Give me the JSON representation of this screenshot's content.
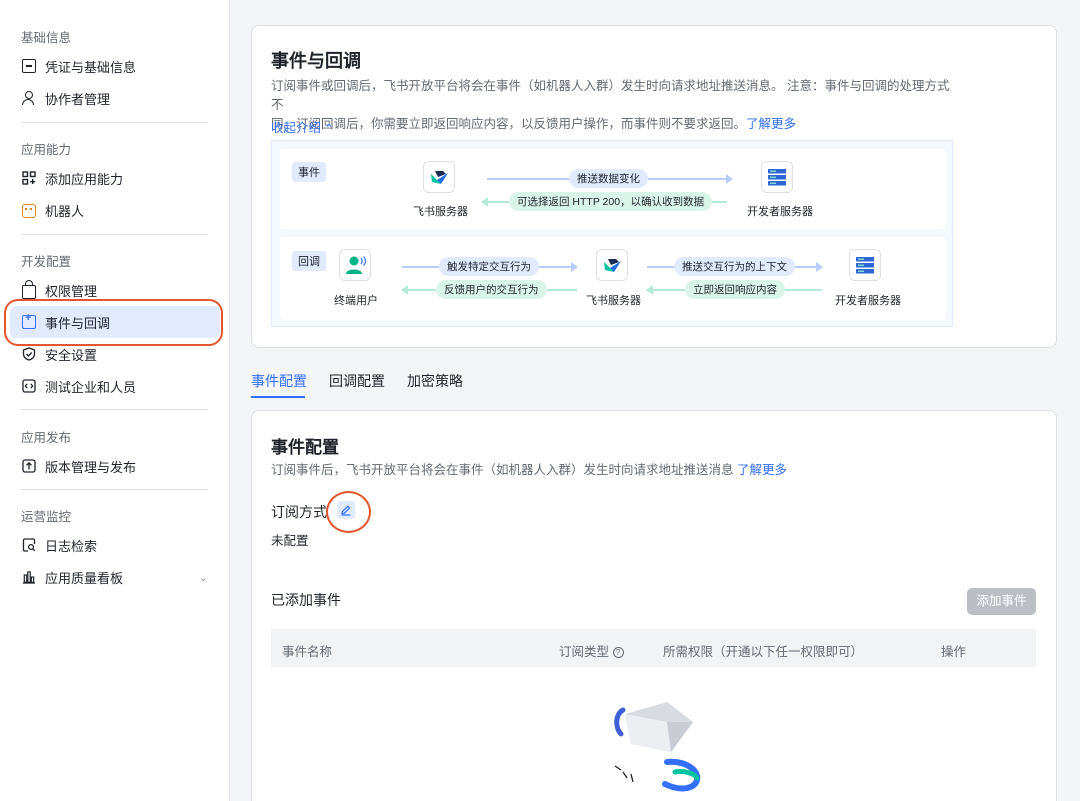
{
  "sidebar": {
    "groups": [
      {
        "title": "基础信息"
      },
      {
        "title": "应用能力"
      },
      {
        "title": "开发配置"
      },
      {
        "title": "应用发布"
      },
      {
        "title": "运营监控"
      }
    ],
    "items": [
      {
        "label": "凭证与基础信息",
        "icon": "credential-icon"
      },
      {
        "label": "协作者管理",
        "icon": "collaborator-icon"
      },
      {
        "label": "添加应用能力",
        "icon": "add-capability-icon"
      },
      {
        "label": "机器人",
        "icon": "robot-icon"
      },
      {
        "label": "权限管理",
        "icon": "lock-icon"
      },
      {
        "label": "事件与回调",
        "icon": "event-icon",
        "active": true
      },
      {
        "label": "安全设置",
        "icon": "shield-icon"
      },
      {
        "label": "测试企业和人员",
        "icon": "code-icon"
      },
      {
        "label": "版本管理与发布",
        "icon": "upload-icon"
      },
      {
        "label": "日志检索",
        "icon": "log-search-icon"
      },
      {
        "label": "应用质量看板",
        "icon": "chart-icon"
      }
    ]
  },
  "intro": {
    "title": "事件与回调",
    "description_line1": "订阅事件或回调后，飞书开放平台将会在事件（如机器人入群）发生时向请求地址推送消息。 注意：事件与回调的处理方式不",
    "description_line2": "同。订阅回调后，你需要立即返回响应内容，以反馈用户操作，而事件则不要求返回。",
    "learn_more": "了解更多",
    "collapse": "收起介绍",
    "diagram": {
      "event_tag": "事件",
      "callback_tag": "回调",
      "feishu_server": "飞书服务器",
      "developer_server": "开发者服务器",
      "end_user": "终端用户",
      "push_data_change": "推送数据变化",
      "optional_return": "可选择返回 HTTP 200，以确认收到数据",
      "trigger_interaction": "触发特定交互行为",
      "feedback_interaction": "反馈用户的交互行为",
      "push_context": "推送交互行为的上下文",
      "return_response": "立即返回响应内容"
    }
  },
  "tabs": [
    "事件配置",
    "回调配置",
    "加密策略"
  ],
  "event_config": {
    "title": "事件配置",
    "description": "订阅事件后，飞书开放平台将会在事件（如机器人入群）发生时向请求地址推送消息",
    "learn_more": "了解更多",
    "subscribe_label": "订阅方式",
    "subscribe_value": "未配置",
    "added_events": "已添加事件",
    "add_button": "添加事件",
    "columns": [
      "事件名称",
      "订阅类型",
      "所需权限（开通以下任一权限即可）",
      "操作"
    ]
  },
  "colors": {
    "accent": "#3370ff",
    "annotation": "#e4572e"
  }
}
